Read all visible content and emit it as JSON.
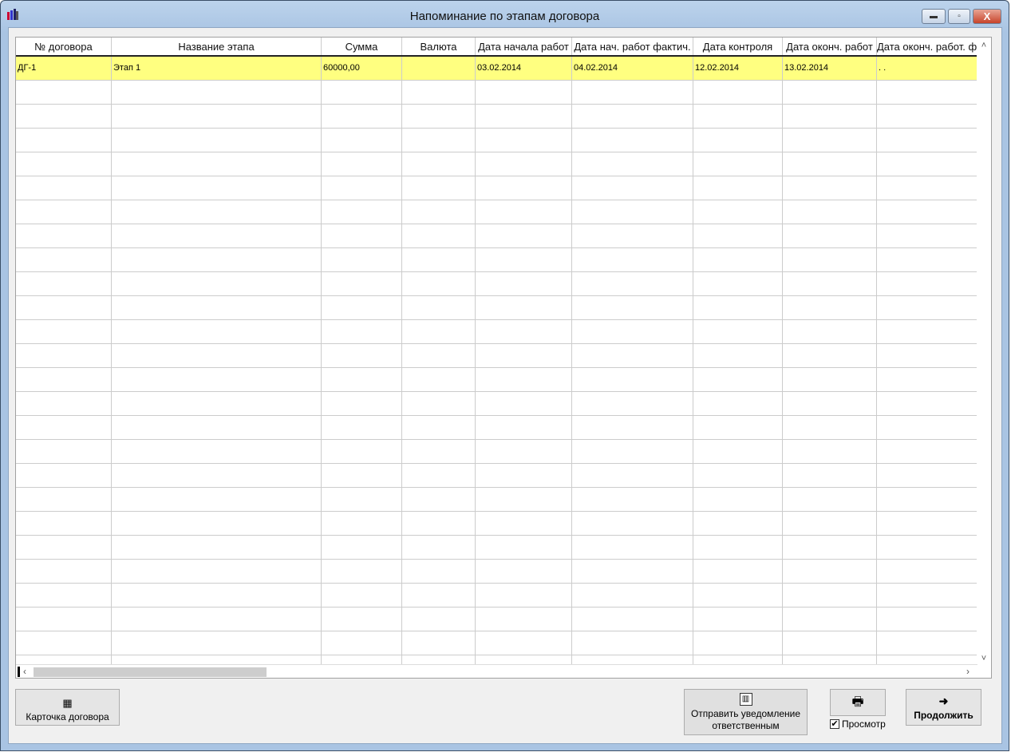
{
  "window": {
    "title": "Напоминание по этапам договора",
    "icon": "bar-chart-books-icon"
  },
  "grid": {
    "columns": [
      "№ договора",
      "Название этапа",
      "Сумма",
      "Валюта",
      "Дата начала работ",
      "Дата нач. работ фактич.",
      "Дата контроля",
      "Дата оконч. работ",
      "Дата оконч. работ. фактич."
    ],
    "rows": [
      [
        "ДГ-1",
        "Этап 1",
        "60000,00",
        "",
        "03.02.2014",
        "04.02.2014",
        "12.02.2014",
        "13.02.2014",
        ". ."
      ]
    ],
    "selected_row_color": "#ffff80"
  },
  "buttons": {
    "card": "Карточка договора",
    "send": "Отправить уведомление ответственным",
    "print_icon": "printer-icon",
    "continue": "Продолжить"
  },
  "preview": {
    "label": "Просмотр",
    "checked": true
  }
}
